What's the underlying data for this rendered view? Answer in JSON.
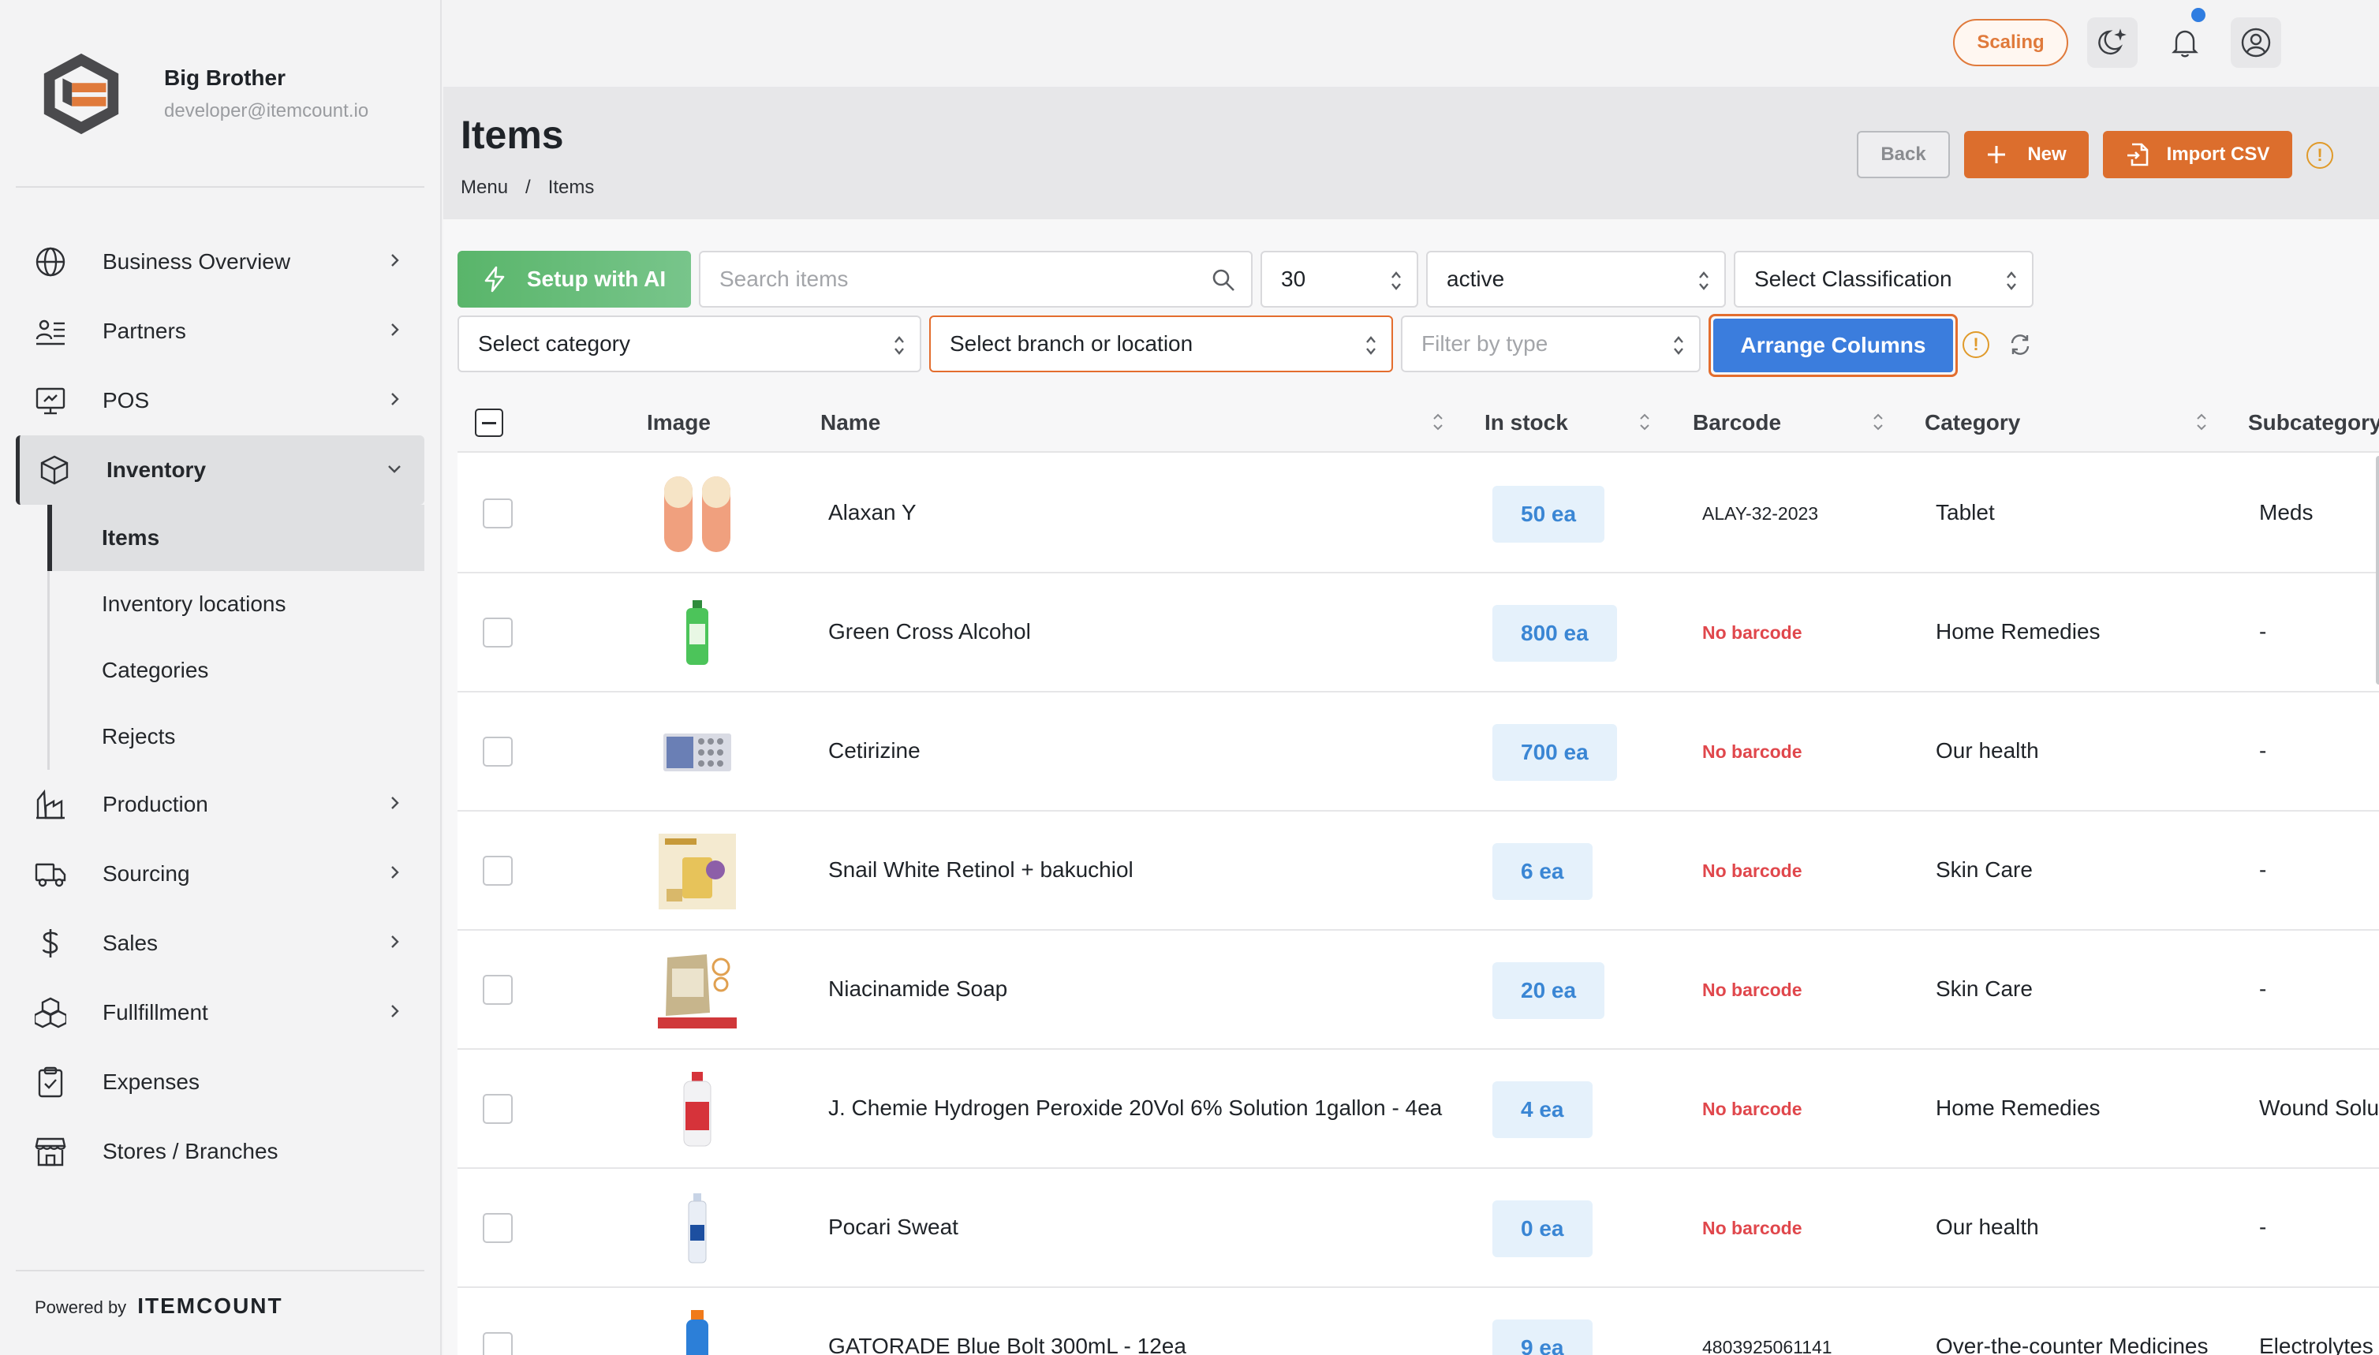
{
  "brand": {
    "name": "Big Brother",
    "email": "developer@itemcount.io"
  },
  "sidebar": {
    "items": [
      {
        "label": "Business Overview",
        "icon": "globe-icon"
      },
      {
        "label": "Partners",
        "icon": "partners-icon"
      },
      {
        "label": "POS",
        "icon": "pos-monitor-icon"
      },
      {
        "label": "Inventory",
        "icon": "box-icon"
      },
      {
        "label": "Production",
        "icon": "factory-icon"
      },
      {
        "label": "Sourcing",
        "icon": "truck-icon"
      },
      {
        "label": "Sales",
        "icon": "dollar-icon"
      },
      {
        "label": "Fullfillment",
        "icon": "boxes-icon"
      },
      {
        "label": "Expenses",
        "icon": "clipboard-icon"
      },
      {
        "label": "Stores / Branches",
        "icon": "store-icon"
      }
    ],
    "inventory_sub": [
      "Items",
      "Inventory locations",
      "Categories",
      "Rejects"
    ],
    "powered_by": "Powered by",
    "powered_brand": "ITEMCOUNT"
  },
  "topbar": {
    "scaling": "Scaling"
  },
  "header": {
    "title": "Items",
    "breadcrumb": [
      "Menu",
      "/",
      "Items"
    ],
    "back": "Back",
    "new": "New",
    "import": "Import CSV",
    "info": "!"
  },
  "toolbar": {
    "setup_ai": "Setup with AI",
    "search_placeholder": "Search items",
    "per_page": "30",
    "status": "active",
    "classification": "Select Classification",
    "category": "Select category",
    "branch": "Select branch or location",
    "type_placeholder": "Filter by type",
    "arrange": "Arrange Columns",
    "info": "!"
  },
  "table": {
    "columns": [
      "Image",
      "Name",
      "In stock",
      "Barcode",
      "Category",
      "Subcategory"
    ],
    "rows": [
      {
        "name": "Alaxan Y",
        "stock": "50 ea",
        "barcode": "ALAY-32-2023",
        "category": "Tablet",
        "subcategory": "Meds",
        "thumb": "capsule"
      },
      {
        "name": "Green Cross Alcohol",
        "stock": "800 ea",
        "barcode": "No barcode",
        "category": "Home Remedies",
        "subcategory": "-",
        "thumb": "bottle-green"
      },
      {
        "name": "Cetirizine",
        "stock": "700 ea",
        "barcode": "No barcode",
        "category": "Our health",
        "subcategory": "-",
        "thumb": "blister"
      },
      {
        "name": "Snail White Retinol + bakuchiol",
        "stock": "6 ea",
        "barcode": "No barcode",
        "category": "Skin Care",
        "subcategory": "-",
        "thumb": "cream-box"
      },
      {
        "name": "Niacinamide Soap",
        "stock": "20 ea",
        "barcode": "No barcode",
        "category": "Skin Care",
        "subcategory": "-",
        "thumb": "soap-pack"
      },
      {
        "name": "J. Chemie Hydrogen Peroxide 20Vol 6% Solution 1gallon - 4ea",
        "stock": "4 ea",
        "barcode": "No barcode",
        "category": "Home Remedies",
        "subcategory": "Wound Solu",
        "thumb": "bottle-red"
      },
      {
        "name": "Pocari Sweat",
        "stock": "0 ea",
        "barcode": "No barcode",
        "category": "Our health",
        "subcategory": "-",
        "thumb": "bottle-white"
      },
      {
        "name": "GATORADE Blue Bolt 300mL - 12ea",
        "stock": "9 ea",
        "barcode": "4803925061141",
        "category": "Over-the-counter Medicines",
        "subcategory": "Electrolytes",
        "thumb": "bottle-blue"
      }
    ]
  },
  "colors": {
    "accent": "#dc6e2d",
    "primary": "#3b7ddd",
    "ai_green": "#59b56a",
    "no_barcode": "#e0474c"
  }
}
